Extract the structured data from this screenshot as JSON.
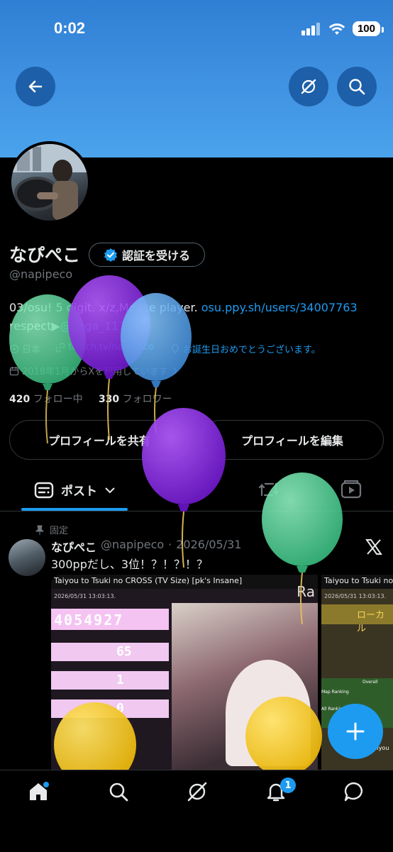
{
  "status_bar": {
    "time": "0:02",
    "battery": "100"
  },
  "profile": {
    "name": "なぴぺこ",
    "verify_label": "認証を受ける",
    "handle": "@napipeco",
    "bio_line1_text": "03/osu! 5 digit. x/z,Mouse player. ",
    "bio_line1_link": "osu.ppy.sh/users/34007763",
    "bio_line2_text": "respect▶",
    "bio_line2_link": "@zaga_1111",
    "location": "日本",
    "website": "twitch.tv/napipeco",
    "birthday": "お誕生日おめでとうございます。",
    "joined": "2018年1月からXを利用しています",
    "following_count": "420",
    "following_label": "フォロー中",
    "followers_count": "330",
    "followers_label": "フォロワー",
    "share_button": "プロフィールを共有",
    "edit_button": "プロフィールを編集"
  },
  "tabs": {
    "posts_label": "ポスト"
  },
  "post": {
    "pinned_label": "固定",
    "author": "なぴぺこ",
    "handle": "@napipeco",
    "separator": "·",
    "date": "2026/05/31",
    "text": "300ppだし、3位！？！？！？",
    "media1_title": "Taiyou to Tsuki no CROSS (TV Size) [pk's Insane]",
    "media1_timestamp": "2026/05/31 13:03:13.",
    "media1_score": "4054927",
    "media1_combo_a": "65",
    "media1_combo_b": "1",
    "media1_combo_c": "0",
    "media1_rank_text": "Ra",
    "media2_title": "Taiyou to Tsuki no",
    "media2_timestamp": "2026/05/31 13:03:13.",
    "media2_local": "ローカル",
    "media2_map_ranking": "Map Ranking",
    "media2_all_ranking": "All Ranking",
    "media2_overall": "Overall",
    "media2_footer": "Taiyou"
  },
  "nav": {
    "notifications_badge": "1"
  },
  "colors": {
    "accent": "#1d9bf0",
    "banner": "#3e8fe0",
    "balloon_green": "#4fd69a",
    "balloon_purple": "#8a2be2",
    "balloon_blue": "#4a9ee8",
    "balloon_yellow": "#f5c518"
  }
}
